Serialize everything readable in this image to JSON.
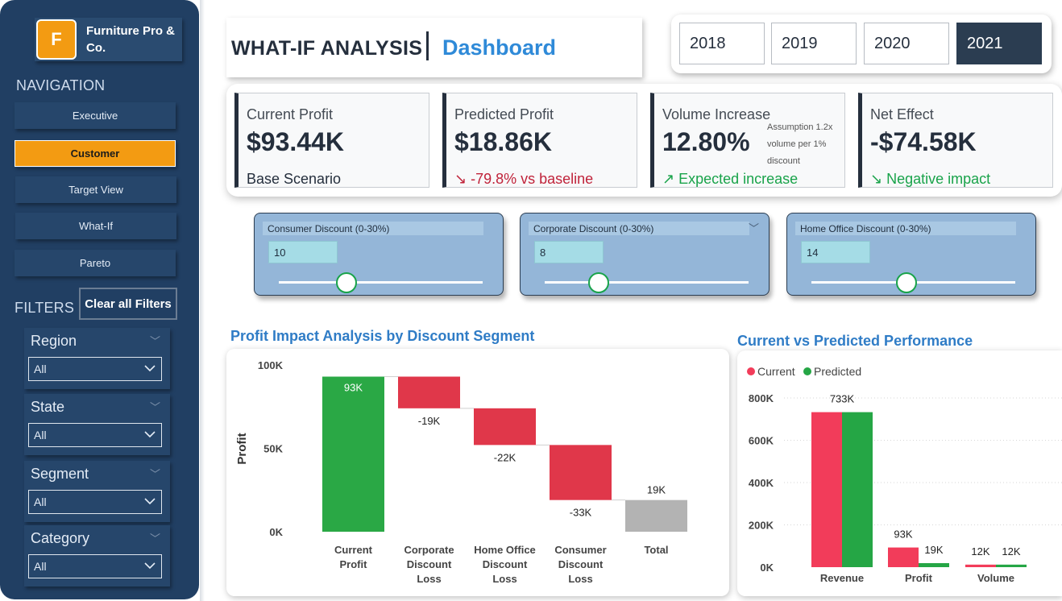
{
  "brand": {
    "logo_letter": "F",
    "name": "Furniture Pro & Co."
  },
  "navigation": {
    "heading": "NAVIGATION",
    "items": [
      {
        "label": "Executive",
        "active": false
      },
      {
        "label": "Customer",
        "active": true
      },
      {
        "label": "Target View",
        "active": false
      },
      {
        "label": "What-If",
        "active": false
      },
      {
        "label": "Pareto",
        "active": false
      }
    ]
  },
  "filters": {
    "heading": "FILTERS",
    "clear_label": "Clear all Filters",
    "items": [
      {
        "label": "Region",
        "value": "All"
      },
      {
        "label": "State",
        "value": "All"
      },
      {
        "label": "Segment",
        "value": "All"
      },
      {
        "label": "Category",
        "value": "All"
      }
    ]
  },
  "header": {
    "title": "WHAT-IF ANALYSIS",
    "subtitle": "Dashboard"
  },
  "years": {
    "options": [
      "2018",
      "2019",
      "2020",
      "2021"
    ],
    "selected": "2021"
  },
  "kpis": [
    {
      "title": "Current Profit",
      "value": "$93.44K",
      "footer": "Base Scenario"
    },
    {
      "title": "Predicted Profit",
      "value": "$18.86K",
      "footer": "↘ -79.8% vs baseline"
    },
    {
      "title": "Volume Increase",
      "value": "12.80%",
      "note": "Assumption 1.2x volume per 1% discount",
      "footer": "↗ Expected increase"
    },
    {
      "title": "Net Effect",
      "value": "-$74.58K",
      "footer": "↘ Negative impact"
    }
  ],
  "sliders": [
    {
      "label": "Consumer Discount (0-30%)",
      "value": "10",
      "fraction": 0.3333
    },
    {
      "label": "Corporate Discount (0-30%)",
      "value": "8",
      "fraction": 0.2667
    },
    {
      "label": "Home Office Discount (0-30%)",
      "value": "14",
      "fraction": 0.4667
    }
  ],
  "chart_titles": {
    "waterfall": "Profit Impact Analysis by Discount Segment",
    "comparison": "Current vs Predicted Performance"
  },
  "colors": {
    "green": "#2aa845",
    "red": "#e0374a",
    "gray": "#b3b3b3",
    "current": "#f23c5a",
    "predicted": "#25a645",
    "navy": "#213f63",
    "orange": "#f39b12"
  },
  "chart_data": [
    {
      "type": "waterfall",
      "title": "Profit Impact Analysis by Discount Segment",
      "ylabel": "Profit",
      "ylim": [
        0,
        100000
      ],
      "yticks": [
        "0K",
        "50K",
        "100K"
      ],
      "categories": [
        [
          "Current",
          "Profit"
        ],
        [
          "Corporate",
          "Discount",
          "Loss"
        ],
        [
          "Home Office",
          "Discount",
          "Loss"
        ],
        [
          "Consumer",
          "Discount",
          "Loss"
        ],
        [
          "Total"
        ]
      ],
      "steps": [
        {
          "kind": "start",
          "value": 93000,
          "label": "93K"
        },
        {
          "kind": "decrease",
          "value": -19000,
          "label": "-19K"
        },
        {
          "kind": "decrease",
          "value": -22000,
          "label": "-22K"
        },
        {
          "kind": "decrease",
          "value": -33000,
          "label": "-33K"
        },
        {
          "kind": "total",
          "value": 19000,
          "label": "19K"
        }
      ]
    },
    {
      "type": "bar",
      "title": "Current vs Predicted Performance",
      "categories": [
        "Revenue",
        "Profit",
        "Volume"
      ],
      "ylim": [
        0,
        800000
      ],
      "yticks": [
        "0K",
        "200K",
        "400K",
        "600K",
        "800K"
      ],
      "legend": "top-left",
      "series": [
        {
          "name": "Current",
          "values": [
            733000,
            93000,
            12000
          ],
          "labels": [
            "733K",
            "93K",
            "12K"
          ]
        },
        {
          "name": "Predicted",
          "values": [
            733000,
            19000,
            12000
          ],
          "labels": [
            "",
            "19K",
            "12K"
          ]
        }
      ]
    }
  ]
}
